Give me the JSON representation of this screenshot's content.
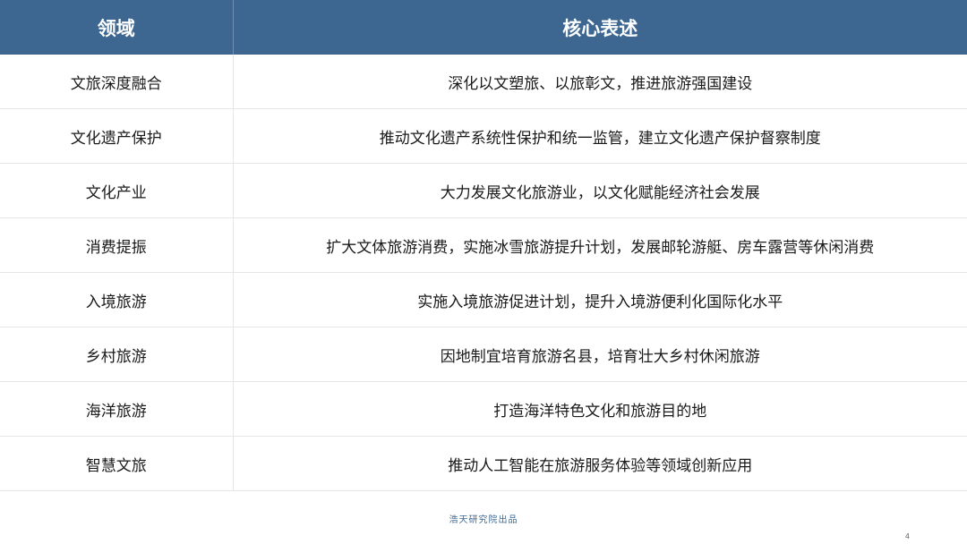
{
  "table": {
    "headers": [
      "领域",
      "核心表述"
    ],
    "rows": [
      {
        "field": "文旅深度融合",
        "statement": "深化以文塑旅、以旅彰文，推进旅游强国建设"
      },
      {
        "field": "文化遗产保护",
        "statement": "推动文化遗产系统性保护和统一监管，建立文化遗产保护督察制度"
      },
      {
        "field": "文化产业",
        "statement": "大力发展文化旅游业，以文化赋能经济社会发展"
      },
      {
        "field": "消费提振",
        "statement": "扩大文体旅游消费，实施冰雪旅游提升计划，发展邮轮游艇、房车露营等休闲消费"
      },
      {
        "field": "入境旅游",
        "statement": "实施入境旅游促进计划，提升入境游便利化国际化水平"
      },
      {
        "field": "乡村旅游",
        "statement": "因地制宜培育旅游名县，培育壮大乡村休闲旅游"
      },
      {
        "field": "海洋旅游",
        "statement": "打造海洋特色文化和旅游目的地"
      },
      {
        "field": "智慧文旅",
        "statement": "推动人工智能在旅游服务体验等领域创新应用"
      }
    ]
  },
  "footer": {
    "credit": "浩天研究院出品",
    "page_number": "4"
  },
  "colors": {
    "header_bg": "#3d6791",
    "header_text": "#ffffff",
    "body_text": "#1a1a1a",
    "credit_text": "#3d6791"
  }
}
